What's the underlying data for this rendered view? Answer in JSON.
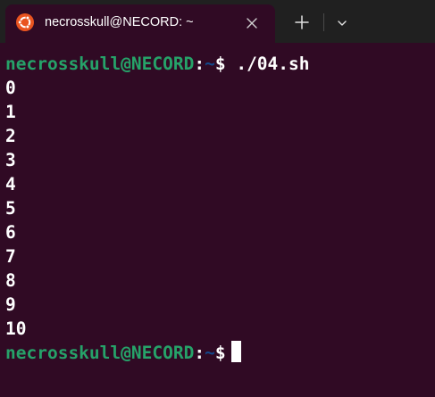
{
  "tab": {
    "title": "necrosskull@NECORD: ~",
    "icon": "ubuntu-logo-icon"
  },
  "titlebar": {
    "new_tab_icon": "plus-icon",
    "dropdown_icon": "chevron-down-icon",
    "close_icon": "close-icon"
  },
  "colors": {
    "background": "#300a24",
    "titlebar": "#202020",
    "user_host": "#26a269",
    "path": "#12488b",
    "text": "#ffffff",
    "ubuntu_orange": "#e95420"
  },
  "terminal": {
    "prompt_user": "necrosskull@NECORD",
    "prompt_colon": ":",
    "prompt_path": "~",
    "prompt_symbol": "$",
    "command": "./04.sh",
    "output": [
      "0",
      "1",
      "2",
      "3",
      "4",
      "5",
      "6",
      "7",
      "8",
      "9",
      "10"
    ]
  }
}
